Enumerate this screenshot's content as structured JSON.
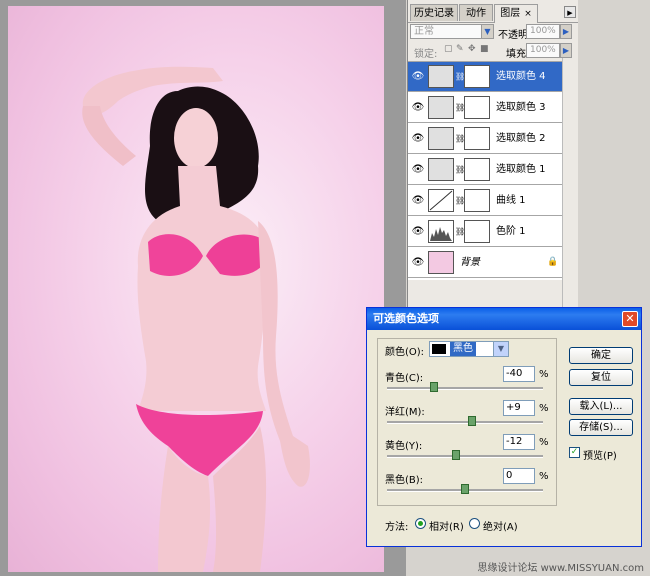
{
  "layers_panel": {
    "tabs": [
      {
        "label": "历史记录"
      },
      {
        "label": "动作"
      },
      {
        "label": "图层",
        "close": "×"
      }
    ],
    "blend_mode": "正常",
    "opacity_label": "不透明度:",
    "opacity_value": "100%",
    "lock_label": "锁定:",
    "fill_label": "填充:",
    "fill_value": "100%",
    "layers": [
      {
        "name": "选取颜色 4",
        "selected": true
      },
      {
        "name": "选取颜色 3"
      },
      {
        "name": "选取颜色 2"
      },
      {
        "name": "选取颜色 1"
      },
      {
        "name": "曲线 1"
      },
      {
        "name": "色阶 1"
      },
      {
        "name": "背景"
      }
    ]
  },
  "dialog": {
    "title": "可选颜色选项",
    "colors_label": "颜色(O):",
    "colors_value": "黑色",
    "sliders": [
      {
        "label": "青色(C):",
        "value": "-40",
        "unit": "%",
        "fraction": 0.3
      },
      {
        "label": "洋红(M):",
        "value": "+9",
        "unit": "%",
        "fraction": 0.545
      },
      {
        "label": "黄色(Y):",
        "value": "-12",
        "unit": "%",
        "fraction": 0.44
      },
      {
        "label": "黑色(B):",
        "value": "0",
        "unit": "%",
        "fraction": 0.5
      }
    ],
    "buttons": {
      "ok": "确定",
      "reset": "复位",
      "load": "载入(L)...",
      "save": "存储(S)..."
    },
    "preview_label": "预览(P)",
    "method_label": "方法:",
    "relative_label": "相对(R)",
    "absolute_label": "绝对(A)"
  },
  "watermark": "思缘设计论坛 www.MISSYUAN.com"
}
